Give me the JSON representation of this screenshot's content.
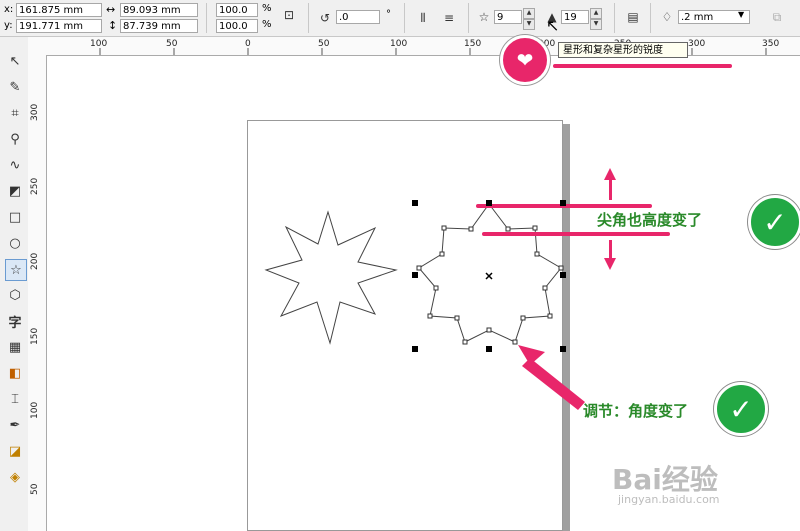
{
  "propbar": {
    "x_label": "x:",
    "x_value": "161.875 mm",
    "y_label": "y:",
    "y_value": "191.771 mm",
    "w_value": "89.093 mm",
    "h_value": "87.739 mm",
    "scale_w": "100.0",
    "scale_h": "100.0",
    "percent": "%",
    "rotation": ".0",
    "degree": "°",
    "points": "9",
    "sharpness": "19",
    "outline_width": ".2 mm"
  },
  "tooltip": "星形和复杂星形的锐度",
  "ruler": {
    "h_ticks": [
      "100",
      "50",
      "0",
      "50",
      "100",
      "150",
      "200",
      "250",
      "300",
      "350"
    ],
    "v_ticks": [
      "300",
      "250",
      "200",
      "150",
      "100",
      "50"
    ]
  },
  "annotations": {
    "top_text": "尖角也高度变了",
    "bottom_text": "调节：角度变了"
  },
  "watermark": {
    "main": "Bai经验",
    "sub": "jingyan.baidu.com"
  },
  "colors": {
    "accent_pink": "#e8266a",
    "check_green": "#22a844",
    "anno_text": "#2a8a2a"
  },
  "icons": {
    "tools": [
      "pick-icon",
      "shape-icon",
      "crop-icon",
      "zoom-icon",
      "freehand-icon",
      "smart-fill-icon",
      "rectangle-icon",
      "ellipse-icon",
      "star-icon",
      "basic-shapes-icon",
      "text-icon",
      "table-icon",
      "blend-icon",
      "eyedropper-icon",
      "outline-pen-icon",
      "fill-icon",
      "interactive-fill-icon"
    ]
  }
}
